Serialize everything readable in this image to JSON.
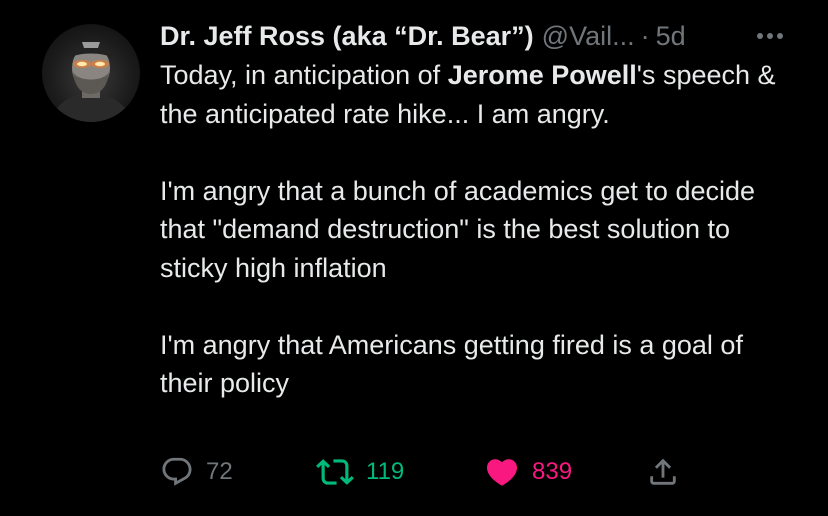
{
  "author": {
    "display_name": "Dr. Jeff Ross (aka “Dr. Bear”)",
    "handle": "@Vail...",
    "separator": "·",
    "time": "5d"
  },
  "tweet": {
    "line1_a": "Today, in anticipation of ",
    "line1_bold": "Jerome Powell",
    "line1_b": "'s speech & the anticipated rate hike... I am angry.",
    "paragraph2": "I'm angry that a bunch of academics get to decide that \"demand destruction\" is the best solution to sticky high inflation",
    "paragraph3": "I'm angry that Americans getting fired is a goal of their policy"
  },
  "actions": {
    "replies": "72",
    "retweets": "119",
    "likes": "839"
  },
  "icons": {
    "reply": "reply-icon",
    "retweet": "retweet-icon",
    "like": "heart-icon",
    "share": "share-icon",
    "more": "more-icon"
  },
  "colors": {
    "background": "#000000",
    "text": "#e7e9ea",
    "secondary": "#71767b",
    "retweet": "#00ba7c",
    "like": "#f91880"
  }
}
